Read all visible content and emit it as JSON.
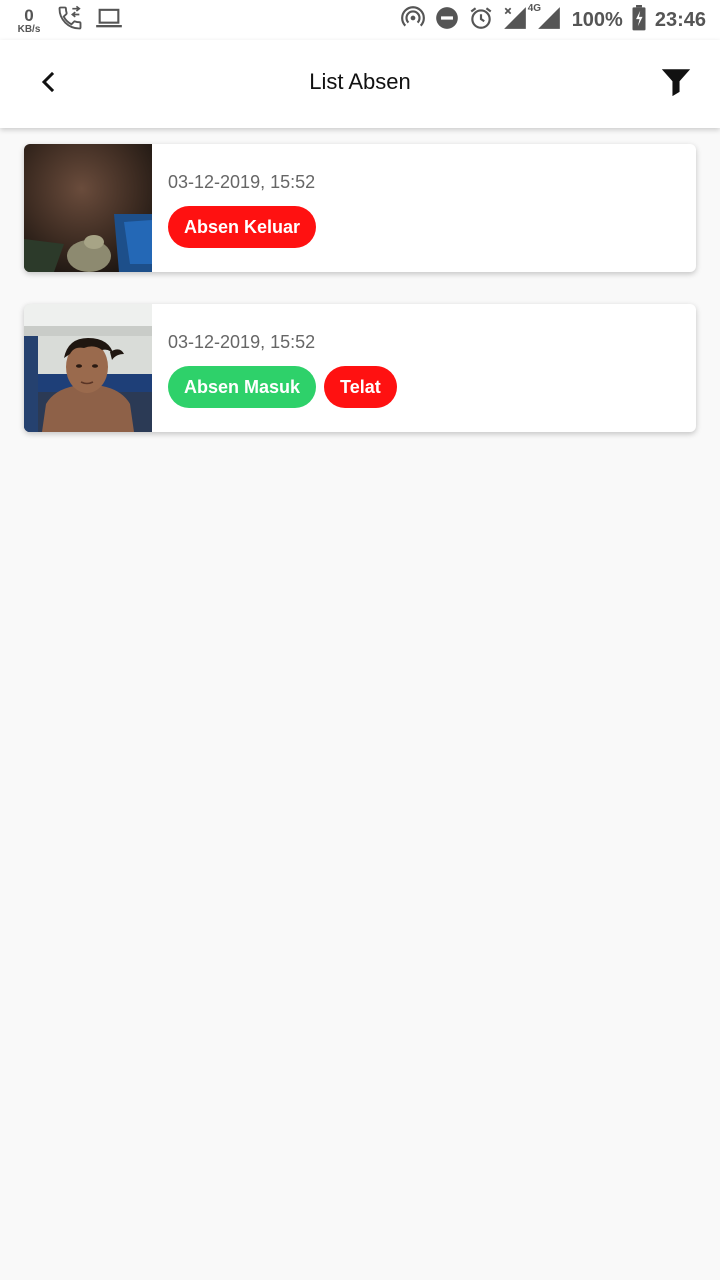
{
  "status_bar": {
    "speed_value": "0",
    "speed_unit": "KB/s",
    "battery": "100%",
    "time": "23:46",
    "network": "4G",
    "left_icons": [
      "call-transfer-icon",
      "laptop-icon"
    ],
    "right_icons": [
      "hotspot-icon",
      "do-not-disturb-icon",
      "alarm-icon",
      "signal-icon",
      "battery-icon"
    ]
  },
  "app_bar": {
    "title": "List Absen",
    "back_icon": "chevron-left-icon",
    "filter_icon": "filter-icon"
  },
  "entries": [
    {
      "datetime": "03-12-2019, 15:52",
      "badges": [
        {
          "label": "Absen Keluar",
          "color": "#ff1111"
        }
      ]
    },
    {
      "datetime": "03-12-2019, 15:52",
      "badges": [
        {
          "label": "Absen Masuk",
          "color": "#2ed16a"
        },
        {
          "label": "Telat",
          "color": "#ff1111"
        }
      ]
    }
  ],
  "colors": {
    "background": "#f9f9f9",
    "surface": "#ffffff",
    "red_badge": "#ff1111",
    "green_badge": "#2ed16a"
  }
}
